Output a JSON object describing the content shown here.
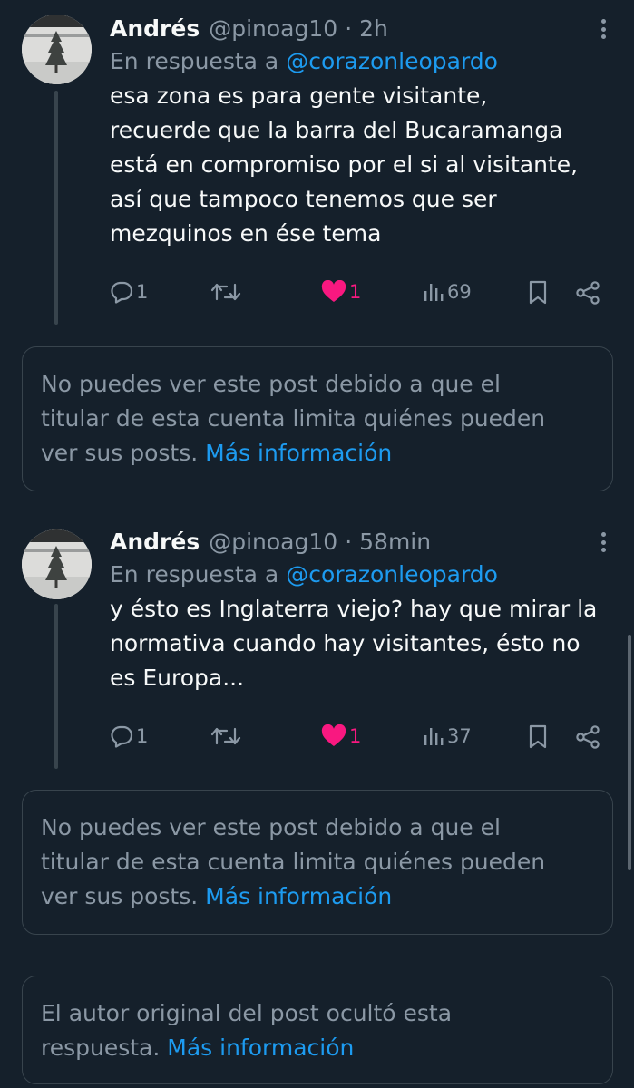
{
  "tweets": [
    {
      "name": "Andrés",
      "handle": "@pinoag10",
      "separator": "·",
      "time": "2h",
      "reply_prefix": "En respuesta a",
      "reply_to": "@corazonleopardo",
      "lines": [
        "esa zona es para gente visitante,",
        "recuerde que la barra del Bucaramanga",
        "está en compromiso por el si al visitante,",
        "así que tampoco tenemos que ser",
        "mezquinos en ése tema"
      ],
      "replies": "1",
      "likes": "1",
      "views": "69"
    },
    {
      "name": "Andrés",
      "handle": "@pinoag10",
      "separator": "·",
      "time": "58min",
      "reply_prefix": "En respuesta a",
      "reply_to": "@corazonleopardo",
      "lines": [
        "y ésto es Inglaterra viejo? hay que mirar la",
        "normativa cuando hay visitantes, ésto no",
        "es Europa..."
      ],
      "replies": "1",
      "likes": "1",
      "views": "37"
    }
  ],
  "notices": [
    {
      "lines": [
        "No puedes ver este post debido a que el",
        "titular de esta cuenta limita quiénes pueden",
        "ver sus posts. "
      ],
      "link": "Más información"
    },
    {
      "lines": [
        "No puedes ver este post debido a que el",
        "titular de esta cuenta limita quiénes pueden",
        "ver sus posts. "
      ],
      "link": "Más información"
    },
    {
      "lines": [
        "El autor original del post ocultó esta",
        "respuesta. "
      ],
      "link": "Más información"
    }
  ],
  "icons": {
    "reply": "speech-bubble-icon",
    "retweet": "repost-arrows-icon",
    "like": "heart-icon",
    "views": "bar-chart-icon",
    "bookmark": "bookmark-icon",
    "share": "share-nodes-icon",
    "more": "vertical-ellipsis-icon"
  },
  "colors": {
    "background": "#15202b",
    "text": "#f7f9f9",
    "secondary": "#8b98a5",
    "link": "#1d9bf0",
    "like": "#f91880",
    "border": "#38444d"
  }
}
